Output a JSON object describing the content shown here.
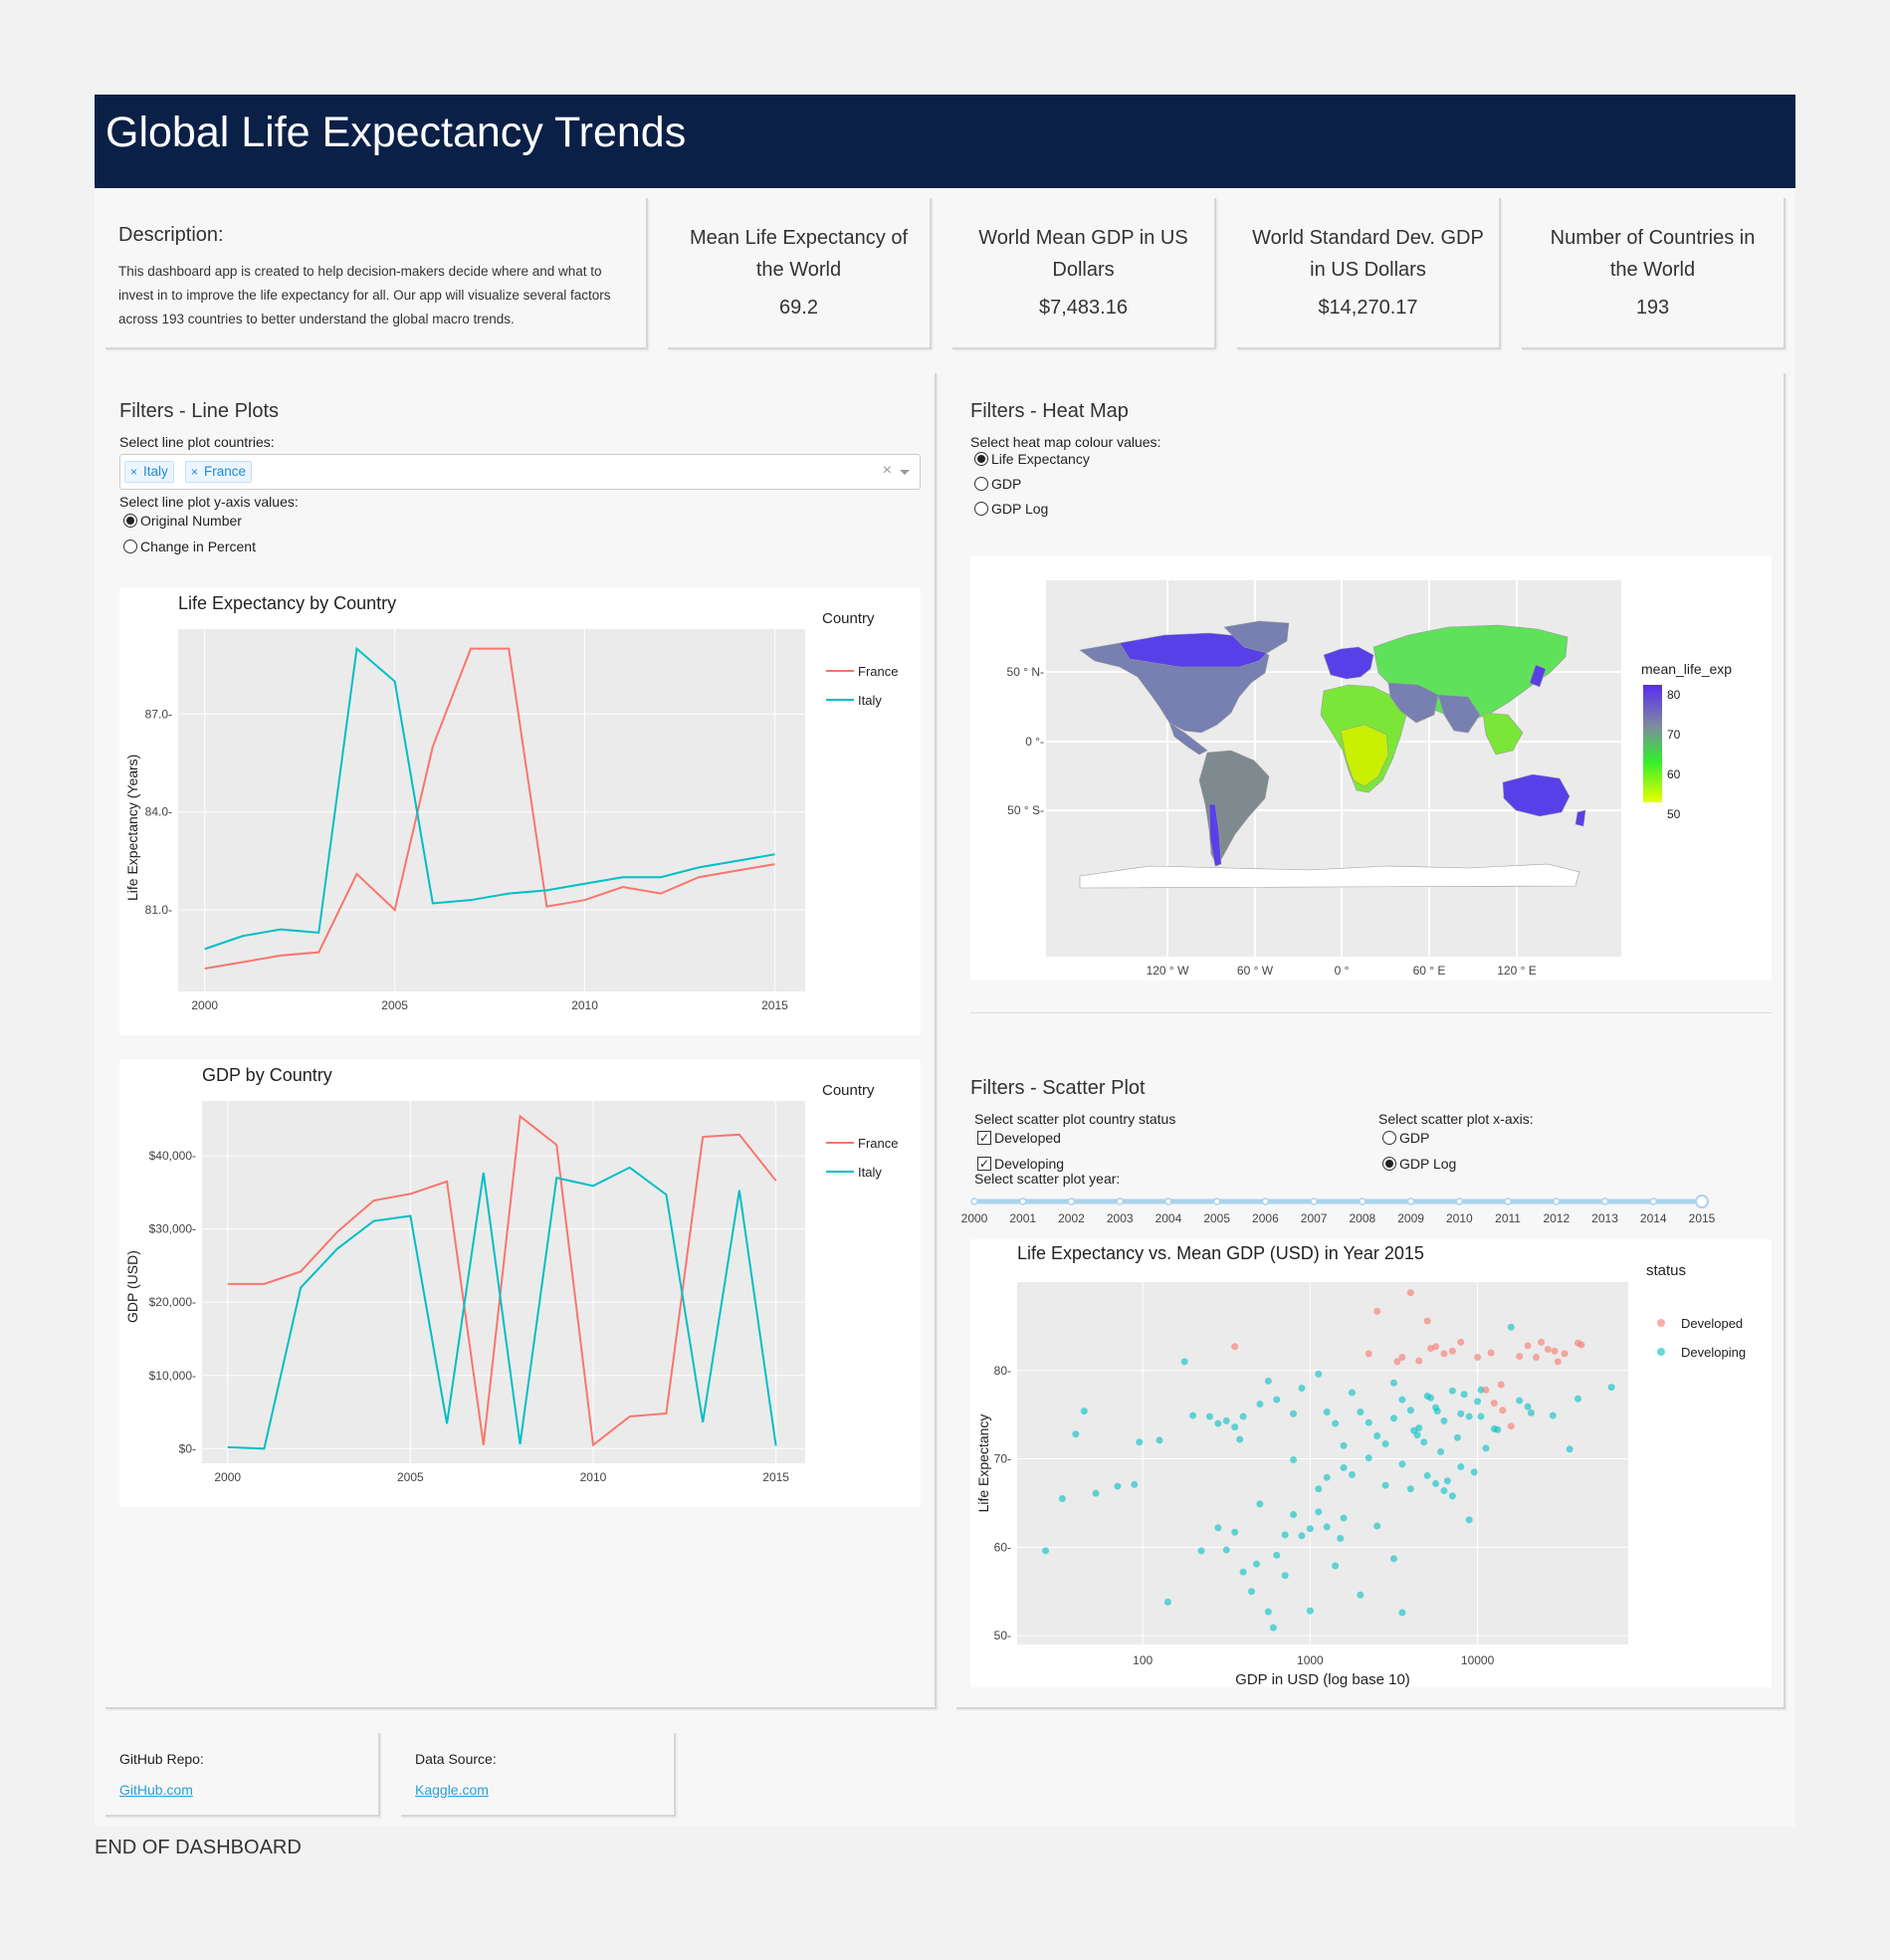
{
  "header": {
    "title": "Global Life Expectancy Trends"
  },
  "description": {
    "title": "Description:",
    "text": "This dashboard app is created to help decision-makers decide where and what to invest in to improve the life expectancy for all. Our app will visualize several factors across 193 countries to better understand the global macro trends."
  },
  "stats": [
    {
      "label": "Mean Life Expectancy of the World",
      "value": "69.2"
    },
    {
      "label": "World Mean GDP in US Dollars",
      "value": "$7,483.16"
    },
    {
      "label": "World Standard Dev. GDP in US Dollars",
      "value": "$14,270.17"
    },
    {
      "label": "Number of Countries in the World",
      "value": "193"
    }
  ],
  "line_filters": {
    "title": "Filters - Line Plots",
    "countries_label": "Select line plot countries:",
    "selected_countries": [
      "Italy",
      "France"
    ],
    "clear_symbol": "×",
    "remove_symbol": "×",
    "yaxis_label": "Select line plot y-axis values:",
    "yaxis_options": [
      "Original Number",
      "Change in Percent"
    ],
    "yaxis_selected": "Original Number"
  },
  "heat_filters": {
    "title": "Filters - Heat Map",
    "colour_label": "Select heat map colour values:",
    "options": [
      "Life Expectancy",
      "GDP",
      "GDP Log"
    ],
    "selected": "Life Expectancy"
  },
  "scatter_filters": {
    "title": "Filters - Scatter Plot",
    "status_label": "Select scatter plot country status",
    "status_options": [
      "Developed",
      "Developing"
    ],
    "xaxis_label": "Select scatter plot x-axis:",
    "xaxis_options": [
      "GDP",
      "GDP Log"
    ],
    "xaxis_selected": "GDP Log",
    "year_label": "Select scatter plot year:",
    "years": [
      "2000",
      "2001",
      "2002",
      "2003",
      "2004",
      "2005",
      "2006",
      "2007",
      "2008",
      "2009",
      "2010",
      "2011",
      "2012",
      "2013",
      "2014",
      "2015"
    ],
    "year_selected": "2015",
    "check_mark": "✓"
  },
  "footer": {
    "github_label": "GitHub Repo:",
    "github_link": "GitHub.com",
    "data_label": "Data Source:",
    "data_link": "Kaggle.com",
    "end_text": "END OF DASHBOARD"
  },
  "colors": {
    "france": "#f8766d",
    "italy": "#00bfc4",
    "developed": "#f8766d",
    "developing": "#00bfc4",
    "header": "#0b2047"
  },
  "chart_data": [
    {
      "type": "line",
      "title": "Life Expectancy by Country",
      "xlabel": "",
      "ylabel": "Life Expectancy (Years)",
      "legend_title": "Country",
      "x": [
        2000,
        2001,
        2002,
        2003,
        2004,
        2005,
        2006,
        2007,
        2008,
        2009,
        2010,
        2011,
        2012,
        2013,
        2014,
        2015
      ],
      "xticks": [
        "2000",
        "2005",
        "2010",
        "2015"
      ],
      "yticks": [
        "81.0",
        "84.0",
        "87.0"
      ],
      "xlim": [
        1999.3,
        2015.8
      ],
      "ylim": [
        78.5,
        89.6
      ],
      "series": [
        {
          "name": "France",
          "values": [
            79.2,
            79.4,
            79.6,
            79.7,
            82.1,
            81.0,
            86.0,
            89.0,
            89.0,
            81.1,
            81.3,
            81.7,
            81.5,
            82.0,
            82.2,
            82.4
          ]
        },
        {
          "name": "Italy",
          "values": [
            79.8,
            80.2,
            80.4,
            80.3,
            89.0,
            88.0,
            81.2,
            81.3,
            81.5,
            81.6,
            81.8,
            82.0,
            82.0,
            82.3,
            82.5,
            82.7
          ]
        }
      ]
    },
    {
      "type": "line",
      "title": "GDP by Country",
      "xlabel": "",
      "ylabel": "GDP (USD)",
      "legend_title": "Country",
      "x": [
        2000,
        2001,
        2002,
        2003,
        2004,
        2005,
        2006,
        2007,
        2008,
        2009,
        2010,
        2011,
        2012,
        2013,
        2014,
        2015
      ],
      "xticks": [
        "2000",
        "2005",
        "2010",
        "2015"
      ],
      "yticks": [
        "$0",
        "$10,000",
        "$20,000",
        "$30,000",
        "$40,000"
      ],
      "ytick_values": [
        0,
        10000,
        20000,
        30000,
        40000
      ],
      "xlim": [
        1999.3,
        2015.8
      ],
      "ylim": [
        -2000,
        47500
      ],
      "series": [
        {
          "name": "France",
          "values": [
            22500,
            22500,
            24200,
            29600,
            33900,
            34800,
            36500,
            500,
            45400,
            41500,
            500,
            4400,
            4800,
            42600,
            42900,
            36600
          ]
        },
        {
          "name": "Italy",
          "values": [
            200,
            0,
            22000,
            27300,
            31100,
            31800,
            3400,
            37700,
            600,
            37000,
            35900,
            38400,
            34700,
            3600,
            35300,
            400
          ]
        }
      ]
    },
    {
      "type": "heatmap",
      "title": "",
      "legend_title": "mean_life_exp",
      "legend_ticks": [
        "80",
        "70",
        "60",
        "50"
      ],
      "xticks": [
        "120 ° W",
        "60 ° W",
        "0 °",
        "60 ° E",
        "120 ° E"
      ],
      "yticks": [
        "50 ° N-",
        "0 °-",
        "50 ° S-"
      ]
    },
    {
      "type": "scatter",
      "title": "Life Expectancy vs. Mean GDP (USD) in Year 2015",
      "xlabel": "GDP in USD (log base 10)",
      "ylabel": "Life Expectancy",
      "legend_title": "status",
      "xscale": "log",
      "xticks": [
        "100",
        "1000",
        "10000"
      ],
      "yticks": [
        "50",
        "60",
        "70",
        "80"
      ],
      "xlim": [
        1.25,
        4.9
      ],
      "ylim": [
        49,
        90
      ],
      "series": [
        {
          "name": "Developed",
          "points": [
            [
              2.55,
              82.7
            ],
            [
              3.35,
              81.9
            ],
            [
              3.55,
              81.5
            ],
            [
              3.6,
              88.8
            ],
            [
              3.4,
              86.7
            ],
            [
              3.7,
              85.6
            ],
            [
              3.72,
              82.5
            ],
            [
              3.75,
              82.7
            ],
            [
              3.8,
              81.9
            ],
            [
              3.65,
              81.1
            ],
            [
              3.85,
              82.2
            ],
            [
              3.9,
              83.2
            ],
            [
              4.0,
              81.5
            ],
            [
              4.05,
              77.8
            ],
            [
              4.1,
              76.3
            ],
            [
              4.15,
              75.5
            ],
            [
              4.2,
              73.7
            ],
            [
              4.3,
              82.8
            ],
            [
              4.38,
              83.2
            ],
            [
              4.42,
              82.4
            ],
            [
              4.48,
              81.0
            ],
            [
              4.52,
              81.9
            ],
            [
              4.6,
              83.1
            ],
            [
              4.62,
              82.9
            ],
            [
              4.25,
              81.6
            ],
            [
              4.08,
              82.0
            ],
            [
              4.14,
              78.4
            ],
            [
              3.52,
              81.0
            ],
            [
              4.46,
              82.2
            ],
            [
              4.35,
              81.5
            ]
          ]
        },
        {
          "name": "Developing",
          "points": [
            [
              1.42,
              59.6
            ],
            [
              1.52,
              65.5
            ],
            [
              1.6,
              72.8
            ],
            [
              1.65,
              75.4
            ],
            [
              1.72,
              66.1
            ],
            [
              1.85,
              66.9
            ],
            [
              1.95,
              67.1
            ],
            [
              1.98,
              71.9
            ],
            [
              2.1,
              72.1
            ],
            [
              2.15,
              53.8
            ],
            [
              2.25,
              81.0
            ],
            [
              2.3,
              74.9
            ],
            [
              2.4,
              74.8
            ],
            [
              2.45,
              74.0
            ],
            [
              2.5,
              74.3
            ],
            [
              2.55,
              73.6
            ],
            [
              2.6,
              74.8
            ],
            [
              2.7,
              76.2
            ],
            [
              2.75,
              78.8
            ],
            [
              2.8,
              76.7
            ],
            [
              2.9,
              69.9
            ],
            [
              2.95,
              78.0
            ],
            [
              3.05,
              79.6
            ],
            [
              3.1,
              75.3
            ],
            [
              3.15,
              74.0
            ],
            [
              3.2,
              69.0
            ],
            [
              3.25,
              77.5
            ],
            [
              3.3,
              75.3
            ],
            [
              3.35,
              74.1
            ],
            [
              3.4,
              72.6
            ],
            [
              3.45,
              71.7
            ],
            [
              3.5,
              74.6
            ],
            [
              3.55,
              76.7
            ],
            [
              3.6,
              75.5
            ],
            [
              3.65,
              73.5
            ],
            [
              3.7,
              77.1
            ],
            [
              3.72,
              76.9
            ],
            [
              3.75,
              75.8
            ],
            [
              3.8,
              74.3
            ],
            [
              3.85,
              77.7
            ],
            [
              3.9,
              75.1
            ],
            [
              3.95,
              74.8
            ],
            [
              4.0,
              76.5
            ],
            [
              4.05,
              71.2
            ],
            [
              4.1,
              73.4
            ],
            [
              4.2,
              84.9
            ],
            [
              4.25,
              76.6
            ],
            [
              4.3,
              75.9
            ],
            [
              4.45,
              74.9
            ],
            [
              4.55,
              71.1
            ],
            [
              4.6,
              76.8
            ],
            [
              4.8,
              78.1
            ],
            [
              2.45,
              62.2
            ],
            [
              2.5,
              59.7
            ],
            [
              2.55,
              61.7
            ],
            [
              2.6,
              57.2
            ],
            [
              2.65,
              55.0
            ],
            [
              2.7,
              64.9
            ],
            [
              2.75,
              52.7
            ],
            [
              2.8,
              59.1
            ],
            [
              2.85,
              61.4
            ],
            [
              2.9,
              63.7
            ],
            [
              2.95,
              61.3
            ],
            [
              3.0,
              52.8
            ],
            [
              3.05,
              66.6
            ],
            [
              3.1,
              62.3
            ],
            [
              3.15,
              57.9
            ],
            [
              3.2,
              63.3
            ],
            [
              3.3,
              54.6
            ],
            [
              3.4,
              62.4
            ],
            [
              3.5,
              58.7
            ],
            [
              3.55,
              52.6
            ],
            [
              3.6,
              66.6
            ],
            [
              3.7,
              68.1
            ],
            [
              3.75,
              67.2
            ],
            [
              3.8,
              66.4
            ],
            [
              3.85,
              65.8
            ],
            [
              3.9,
              69.1
            ],
            [
              3.95,
              63.1
            ],
            [
              3.05,
              64.0
            ],
            [
              2.85,
              56.8
            ],
            [
              3.1,
              67.9
            ],
            [
              3.18,
              61.0
            ],
            [
              3.25,
              68.2
            ],
            [
              3.35,
              70.1
            ],
            [
              3.45,
              67.0
            ],
            [
              3.55,
              69.4
            ],
            [
              3.62,
              73.2
            ],
            [
              3.68,
              71.9
            ],
            [
              3.78,
              70.8
            ],
            [
              3.88,
              72.4
            ],
            [
              3.98,
              68.5
            ],
            [
              2.35,
              59.6
            ],
            [
              2.68,
              58.1
            ],
            [
              2.78,
              50.9
            ],
            [
              3.0,
              62.1
            ],
            [
              2.58,
              72.2
            ],
            [
              2.9,
              75.1
            ],
            [
              3.2,
              71.5
            ],
            [
              3.5,
              78.6
            ],
            [
              3.76,
              75.4
            ],
            [
              3.92,
              77.3
            ],
            [
              3.64,
              72.7
            ],
            [
              3.82,
              67.5
            ],
            [
              4.02,
              74.8
            ],
            [
              4.12,
              73.3
            ],
            [
              4.32,
              75.2
            ],
            [
              4.02,
              77.8
            ]
          ]
        }
      ]
    }
  ]
}
